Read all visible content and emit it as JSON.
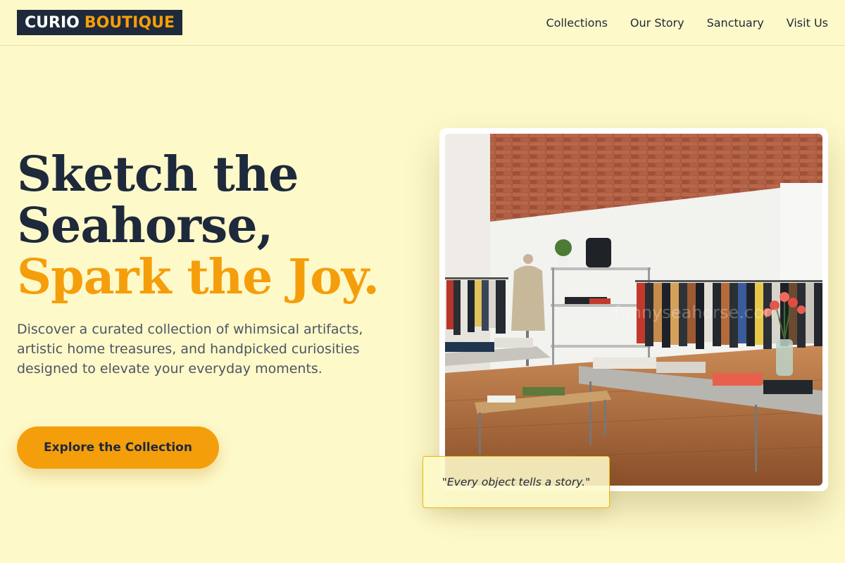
{
  "header": {
    "logo_part1": "CURIO",
    "logo_part2": "BOUTIQUE",
    "nav": [
      "Collections",
      "Our Story",
      "Sanctuary",
      "Visit Us"
    ]
  },
  "hero": {
    "headline_line1": "Sketch the",
    "headline_line2": "Seahorse,",
    "headline_accent": "Spark the Joy.",
    "subtext": "Discover a curated collection of whimsical artifacts, artistic home treasures, and handpicked curiosities designed to elevate your everyday moments.",
    "cta_label": "Explore the Collection"
  },
  "showcase": {
    "image_subject": "boutique-clothing-store-interior",
    "watermark_text": "funnyseahorse.com",
    "quote": "\"Every object tells a story.\""
  },
  "colors": {
    "background": "#fef9c9",
    "accent": "#f59e0b",
    "dark": "#1e293b",
    "body_text": "#4b5563"
  }
}
